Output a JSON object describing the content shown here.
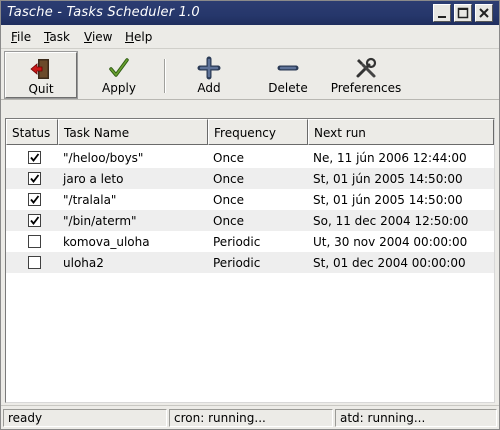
{
  "window": {
    "title": "Tasche - Tasks Scheduler 1.0"
  },
  "menu": [
    {
      "label_u": "F",
      "label_rest": "ile"
    },
    {
      "label_u": "T",
      "label_rest": "ask"
    },
    {
      "label_u": "V",
      "label_rest": "iew"
    },
    {
      "label_u": "H",
      "label_rest": "elp"
    }
  ],
  "toolbar": {
    "quit_label": "Quit",
    "apply_label": "Apply",
    "add_label": "Add",
    "delete_label": "Delete",
    "preferences_label": "Preferences"
  },
  "table": {
    "columns": [
      "Status",
      "Task Name",
      "Frequency",
      "Next run"
    ],
    "rows": [
      {
        "checked": true,
        "name": "\"/heloo/boys\"",
        "frequency": "Once",
        "next_run": "Ne, 11 jún 2006 12:44:00"
      },
      {
        "checked": true,
        "name": "jaro a leto",
        "frequency": "Once",
        "next_run": "St, 01 jún 2005 14:50:00"
      },
      {
        "checked": true,
        "name": "\"/tralala\"",
        "frequency": "Once",
        "next_run": "St, 01 jún 2005 14:50:00"
      },
      {
        "checked": true,
        "name": "\"/bin/aterm\"",
        "frequency": "Once",
        "next_run": "So, 11 dec 2004 12:50:00"
      },
      {
        "checked": false,
        "name": "komova_uloha",
        "frequency": "Periodic",
        "next_run": "Ut, 30 nov 2004 00:00:00"
      },
      {
        "checked": false,
        "name": "uloha2",
        "frequency": "Periodic",
        "next_run": "St, 01 dec 2004 00:00:00"
      }
    ]
  },
  "statusbar": {
    "state": "ready",
    "cron": "cron:  running...",
    "atd": "atd:  running..."
  },
  "colors": {
    "titlebar": "#26376b",
    "window_bg": "#ecebe7",
    "row_alt": "#eeeeee"
  },
  "icons": {
    "quit": "exit-door-icon",
    "apply": "checkmark-icon",
    "add": "plus-icon",
    "delete": "minus-icon",
    "preferences": "tools-icon"
  }
}
